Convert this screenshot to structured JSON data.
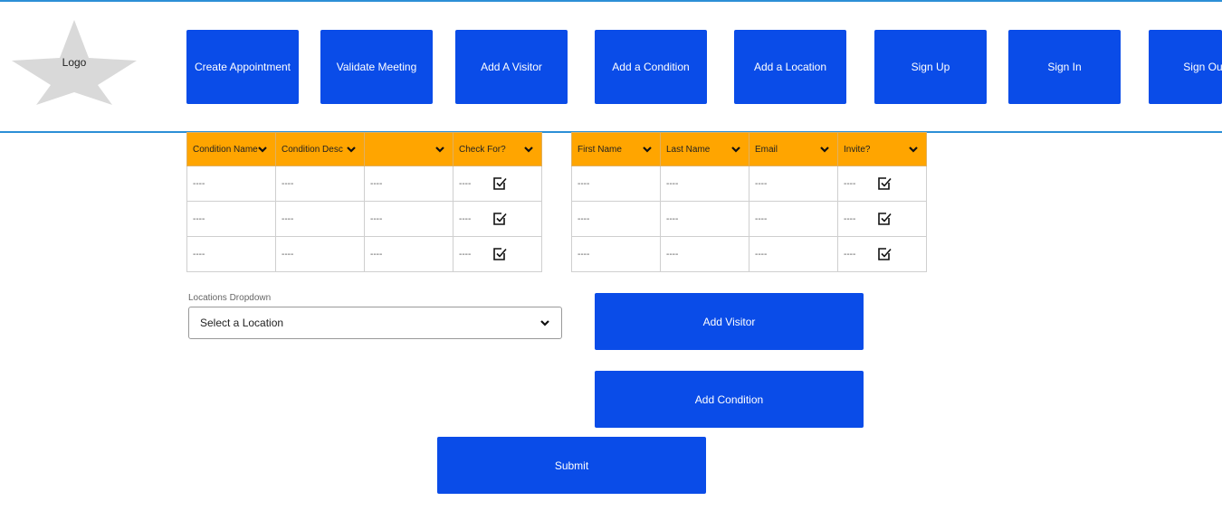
{
  "logo": {
    "label": "Logo",
    "icon": "star-icon"
  },
  "nav": {
    "create_appointment": "Create Appointment",
    "validate_meeting": "Validate Meeting",
    "add_visitor": "Add A Visitor",
    "add_condition": "Add a Condition",
    "add_location": "Add a Location",
    "sign_up": "Sign Up",
    "sign_in": "Sign In",
    "sign_out": "Sign Out"
  },
  "conditions_table": {
    "headers": [
      "Condition Name",
      "Condition Desc",
      "",
      "Check For?"
    ],
    "rows": [
      [
        "----",
        "----",
        "----",
        "----"
      ],
      [
        "----",
        "----",
        "----",
        "----"
      ],
      [
        "----",
        "----",
        "----",
        "----"
      ]
    ]
  },
  "visitors_table": {
    "headers": [
      "First Name",
      "Last Name",
      "Email",
      "Invite?"
    ],
    "rows": [
      [
        "----",
        "----",
        "----",
        "----"
      ],
      [
        "----",
        "----",
        "----",
        "----"
      ],
      [
        "----",
        "----",
        "----",
        "----"
      ]
    ]
  },
  "locations": {
    "label": "Locations Dropdown",
    "selected": "Select a Location"
  },
  "actions": {
    "add_visitor": "Add Visitor",
    "add_condition": "Add Condition",
    "submit": "Submit"
  },
  "colors": {
    "primary": "#0a4ce8",
    "header_orange": "#ffa500",
    "divider_blue": "#2c8fd6"
  }
}
